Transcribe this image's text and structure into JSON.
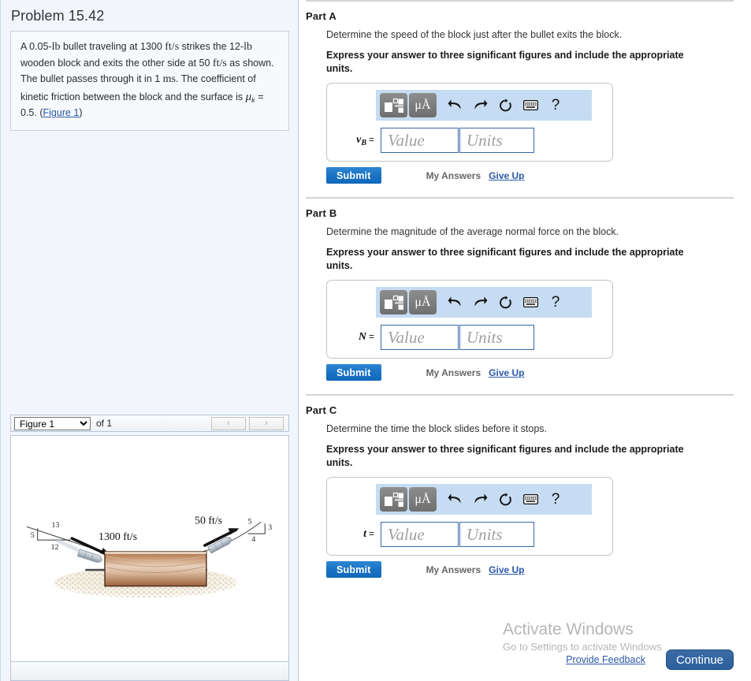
{
  "problem": {
    "title": "Problem 15.42",
    "statement_parts": [
      {
        "t": "A 0.05-",
        "k": "plain"
      },
      {
        "t": "lb",
        "k": "serif"
      },
      {
        "t": " bullet traveling at 1300 ",
        "k": "plain"
      },
      {
        "t": "ft/s",
        "k": "serif"
      },
      {
        "t": " strikes the 12-",
        "k": "plain"
      },
      {
        "t": "lb",
        "k": "serif"
      },
      {
        "t": " wooden block and exits the other side at 50 ",
        "k": "plain"
      },
      {
        "t": "ft/s",
        "k": "serif"
      },
      {
        "t": " as shown. The bullet passes through it in 1 ",
        "k": "plain"
      },
      {
        "t": "ms",
        "k": "serif"
      },
      {
        "t": ". The coefficient of kinetic friction between the block and the surface is ",
        "k": "plain"
      },
      {
        "t": "μ",
        "k": "mu"
      },
      {
        "t": "k",
        "k": "sub"
      },
      {
        "t": " = 0.5. (",
        "k": "plain"
      },
      {
        "t": "Figure 1",
        "k": "link"
      },
      {
        "t": ")",
        "k": "plain"
      }
    ],
    "statement_text": "A 0.05-lb bullet traveling at 1300 ft/s strikes the 12-lb wooden block and exits the other side at 50 ft/s as shown. The bullet passes through it in 1 ms. The coefficient of kinetic friction between the block and the surface is μk = 0.5. (Figure 1)",
    "figure_link_label": "Figure 1"
  },
  "figure": {
    "selected": "Figure 1",
    "options": [
      "Figure 1"
    ],
    "of_label": "of 1",
    "prev_label": "‹",
    "next_label": "›",
    "labels": {
      "incoming_speed": "1300 ft/s",
      "outgoing_speed": "50 ft/s",
      "left_triangle_hyp": "13",
      "left_triangle_vert": "5",
      "left_triangle_horiz": "12",
      "right_triangle_hyp": "5",
      "right_triangle_vert": "3",
      "right_triangle_horiz": "4"
    },
    "colors": {
      "block_top": "#e6cdb6",
      "block_mid": "#c79a76",
      "block_dark": "#8c5434",
      "ground": "#5a5a5a",
      "bullet": "#b9c3cc"
    }
  },
  "mathbar": {
    "template_icon": "math-template-icon",
    "units_label": "μÅ",
    "undo_icon": "undo-arrow-icon",
    "redo_icon": "redo-arrow-icon",
    "reset_icon": "reset-circular-arrow-icon",
    "keyboard_icon": "keyboard-icon",
    "help_label": "?"
  },
  "answer_controls": {
    "value_placeholder": "Value",
    "units_placeholder": "Units",
    "value_current": "",
    "units_current": "",
    "submit_label": "Submit",
    "my_answers_label": "My Answers",
    "give_up_label": "Give Up"
  },
  "parts": [
    {
      "id": "a",
      "title": "Part A",
      "question": "Determine the speed of the block just after the bullet exits the block.",
      "instruction": "Express your answer to three significant figures and include the appropriate units.",
      "var_symbol": "v",
      "var_subscript": "B",
      "equals": "="
    },
    {
      "id": "b",
      "title": "Part B",
      "question": "Determine the magnitude of the average normal force on the block.",
      "instruction": "Express your answer to three significant figures and include the appropriate units.",
      "var_symbol": "N",
      "var_subscript": "",
      "equals": "="
    },
    {
      "id": "c",
      "title": "Part C",
      "question": "Determine the time the block slides before it stops.",
      "instruction": "Express your answer to three significant figures and include the appropriate units.",
      "var_symbol": "t",
      "var_subscript": "",
      "equals": "="
    }
  ],
  "footer": {
    "provide_feedback_label": "Provide Feedback",
    "continue_label": "Continue"
  },
  "watermark": {
    "title": "Activate Windows",
    "subtitle": "Go to Settings to activate Windows"
  },
  "colors": {
    "accent_blue": "#1a72c4",
    "link_blue": "#2b59a8",
    "panel_bg": "#f2f6fc",
    "mathbar_bg": "#c5dcf2",
    "continue_blue": "#2c5f9e"
  }
}
